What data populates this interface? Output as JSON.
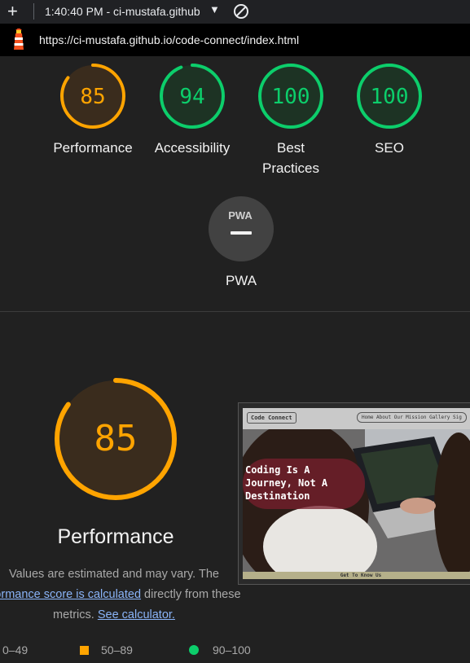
{
  "toolbar": {
    "new_tab_glyph": "+",
    "title": "1:40:40 PM - ci-mustafa.github",
    "dropdown_glyph": "▼",
    "block_icon": "block-icon"
  },
  "urlbar": {
    "logo_icon": "lighthouse-icon",
    "url": "https://ci-mustafa.github.io/code-connect/index.html"
  },
  "colors": {
    "average": "#ffa400",
    "pass": "#0cce6b",
    "fail": "#ff4e42",
    "neutral": "#9e9e9e"
  },
  "scores": [
    {
      "value": "85",
      "label": "Performance",
      "status": "average"
    },
    {
      "value": "94",
      "label": "Accessibility",
      "status": "pass"
    },
    {
      "value": "100",
      "label": "Best Practices",
      "status": "pass"
    },
    {
      "value": "100",
      "label": "SEO",
      "status": "pass"
    }
  ],
  "pwa": {
    "badge_text": "PWA",
    "dash": "—",
    "label": "PWA"
  },
  "performance": {
    "score": "85",
    "title": "Performance",
    "desc_1": "Values are estimated and may vary. The",
    "desc_link_1": "rformance score is calculated",
    "desc_2": " directly from these",
    "desc_3": "metrics. ",
    "desc_link_2": "See calculator."
  },
  "legend": {
    "fail_range": "0–49",
    "average_range": "50–89",
    "pass_range": "90–100"
  },
  "thumbnail": {
    "brand": "Code Connect",
    "menu": "Home About Our Mission Gallery Sig",
    "hero": "Coding Is A\nJourney, Not A\nDestination",
    "footer": "Get To Know Us"
  }
}
